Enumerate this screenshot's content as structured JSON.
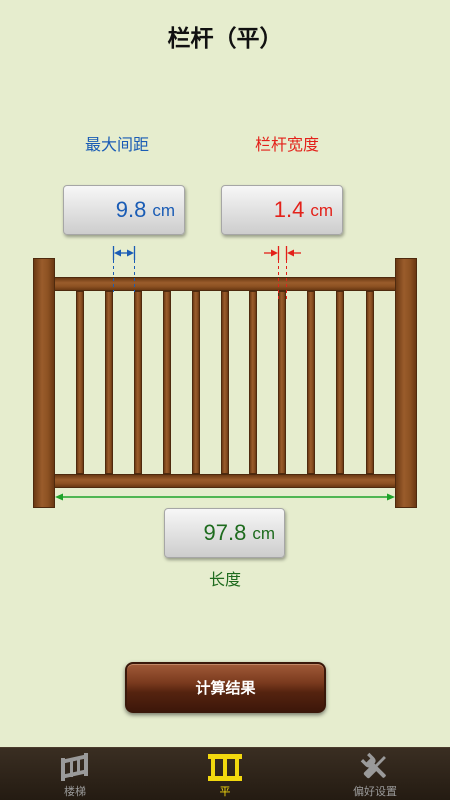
{
  "title": "栏杆（平）",
  "spacing": {
    "label": "最大间距",
    "value": "9.8",
    "unit": "cm"
  },
  "width": {
    "label": "栏杆宽度",
    "value": "1.4",
    "unit": "cm"
  },
  "length": {
    "label": "长度",
    "value": "97.8",
    "unit": "cm"
  },
  "calculate_button": "计算结果",
  "tabs": [
    {
      "label": "楼梯",
      "icon": "ladder-icon",
      "active": false
    },
    {
      "label": "平",
      "icon": "railing-icon",
      "active": true
    },
    {
      "label": "偏好设置",
      "icon": "tools-icon",
      "active": false
    }
  ],
  "colors": {
    "background": "#E6EDCE",
    "spacing": "#1A5CB5",
    "width": "#E3211A",
    "length": "#1E6B1E",
    "length_arrow": "#1FA32A",
    "tab_active": "#F2D80E",
    "tab_inactive": "#9A9A9A"
  }
}
